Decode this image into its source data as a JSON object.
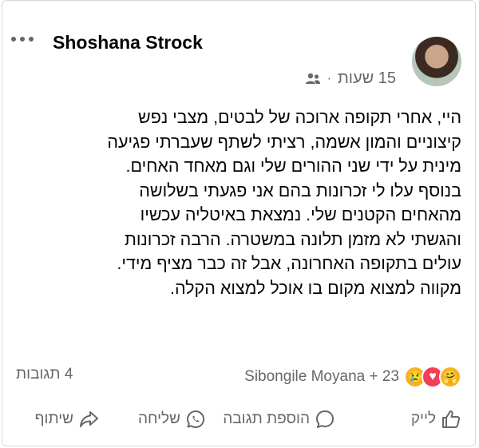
{
  "post": {
    "author": "Shoshana Strock",
    "time": "15 שעות",
    "separator": "·",
    "lines": [
      "היי, אחרי תקופה ארוכה של לבטים, מצבי נפש",
      "קיצוניים והמון אשמה, רציתי לשתף שעברתי פגיעה",
      "מינית על ידי שני ההורים שלי וגם מאחד האחים.",
      "בנוסף עלו לי זכרונות בהם אני פגעתי בשלושה",
      "מהאחים הקטנים שלי. נמצאת באיטליה עכשיו",
      "והגשתי לא מזמן תלונה במשטרה. הרבה זכרונות",
      "עולים בתקופה האחרונה, אבל זה כבר מציף מידי.",
      "מקווה למצוא מקום בו אוכל למצוא הקלה."
    ]
  },
  "reactions": {
    "text": "Sibongile Moyana + 23",
    "icons": [
      "care-emoji",
      "love-emoji",
      "sad-emoji"
    ]
  },
  "comments_count": "4 תגובות",
  "actions": {
    "like": "לייק",
    "comment": "הוספת תגובה",
    "send": "שליחה",
    "share": "שיתוף"
  },
  "colors": {
    "text": "#050505",
    "muted": "#65676b",
    "love": "#f33e58",
    "care": "#f7b125"
  }
}
